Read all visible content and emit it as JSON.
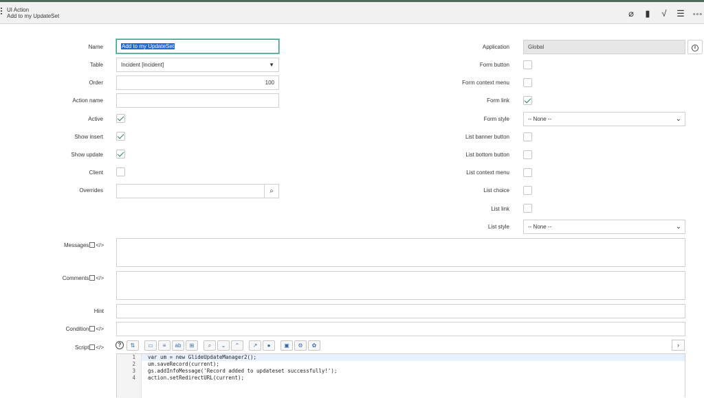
{
  "header": {
    "title": "UI Action",
    "subtitle": "Add to my UpdateSet",
    "icons": [
      "paperclip-icon",
      "clipboard-icon",
      "activity-icon",
      "sliders-icon",
      "more-icon"
    ]
  },
  "left": {
    "name": {
      "label": "Name",
      "value": "Add to my UpdateSet"
    },
    "table": {
      "label": "Table",
      "value": "Incident [incident]"
    },
    "order": {
      "label": "Order",
      "value": "100"
    },
    "action_name": {
      "label": "Action name",
      "value": ""
    },
    "active": {
      "label": "Active",
      "checked": true
    },
    "show_insert": {
      "label": "Show insert",
      "checked": true
    },
    "show_update": {
      "label": "Show update",
      "checked": true
    },
    "client": {
      "label": "Client",
      "checked": false
    },
    "overrides": {
      "label": "Overrides",
      "value": ""
    }
  },
  "right": {
    "application": {
      "label": "Application",
      "value": "Global"
    },
    "form_button": {
      "label": "Form button",
      "checked": false
    },
    "form_context_menu": {
      "label": "Form context menu",
      "checked": false
    },
    "form_link": {
      "label": "Form link",
      "checked": true
    },
    "form_style": {
      "label": "Form style",
      "value": "-- None --"
    },
    "list_banner_button": {
      "label": "List banner button",
      "checked": false
    },
    "list_bottom_button": {
      "label": "List bottom button",
      "checked": false
    },
    "list_context_menu": {
      "label": "List context menu",
      "checked": false
    },
    "list_choice": {
      "label": "List choice",
      "checked": false
    },
    "list_link": {
      "label": "List link",
      "checked": false
    },
    "list_style": {
      "label": "List style",
      "value": "-- None --"
    }
  },
  "wide": {
    "messages": {
      "label": "Messages"
    },
    "comments": {
      "label": "Comments"
    },
    "hint": {
      "label": "Hint"
    },
    "condition": {
      "label": "Condition"
    },
    "script": {
      "label": "Script"
    },
    "code_suffix": "</>"
  },
  "script": {
    "line_numbers": [
      "1",
      "2",
      "3",
      "4"
    ],
    "lines": [
      "var um = new GlideUpdateManager2();",
      "um.saveRecord(current);",
      "gs.addInfoMessage('Record added to updateset successfully!');",
      "action.setRedirectURL(current);"
    ]
  },
  "colors": {
    "accent": "#3e9d8a",
    "check": "#2e7d5b",
    "topbar": "#4f6b5a"
  }
}
